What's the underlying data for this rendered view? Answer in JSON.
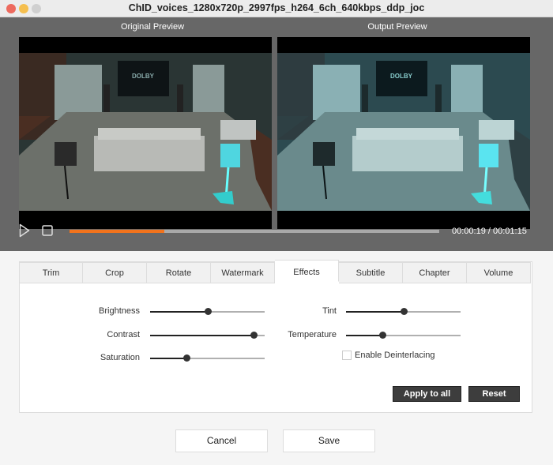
{
  "window": {
    "title": "ChID_voices_1280x720p_2997fps_h264_6ch_640kbps_ddp_joc",
    "traffic_lights": {
      "close": "#ed6a5e",
      "minimize": "#f5bf4f",
      "zoom": "#d0d0d0"
    }
  },
  "preview": {
    "original_label": "Original Preview",
    "output_label": "Output  Preview",
    "video_logo_text": "DOLBY"
  },
  "player": {
    "play_icon": "play-icon",
    "stop_icon": "stop-icon",
    "progress_fraction": 0.257,
    "progress_color": "#f2731c",
    "time_display": "00:00:19 / 00:01:15"
  },
  "tabs": [
    {
      "label": "Trim",
      "active": false
    },
    {
      "label": "Crop",
      "active": false
    },
    {
      "label": "Rotate",
      "active": false
    },
    {
      "label": "Watermark",
      "active": false
    },
    {
      "label": "Effects",
      "active": true
    },
    {
      "label": "Subtitle",
      "active": false
    },
    {
      "label": "Chapter",
      "active": false
    },
    {
      "label": "Volume",
      "active": false
    }
  ],
  "effects": {
    "brightness": {
      "label": "Brightness",
      "value": 0.5
    },
    "contrast": {
      "label": "Contrast",
      "value": 0.9
    },
    "saturation": {
      "label": "Saturation",
      "value": 0.32
    },
    "tint": {
      "label": "Tint",
      "value": 0.5
    },
    "temperature": {
      "label": "Temperature",
      "value": 0.32
    },
    "deinterlace": {
      "label": "Enable Deinterlacing",
      "checked": false
    },
    "apply_all_label": "Apply to all",
    "reset_label": "Reset"
  },
  "footer": {
    "cancel_label": "Cancel",
    "save_label": "Save"
  }
}
